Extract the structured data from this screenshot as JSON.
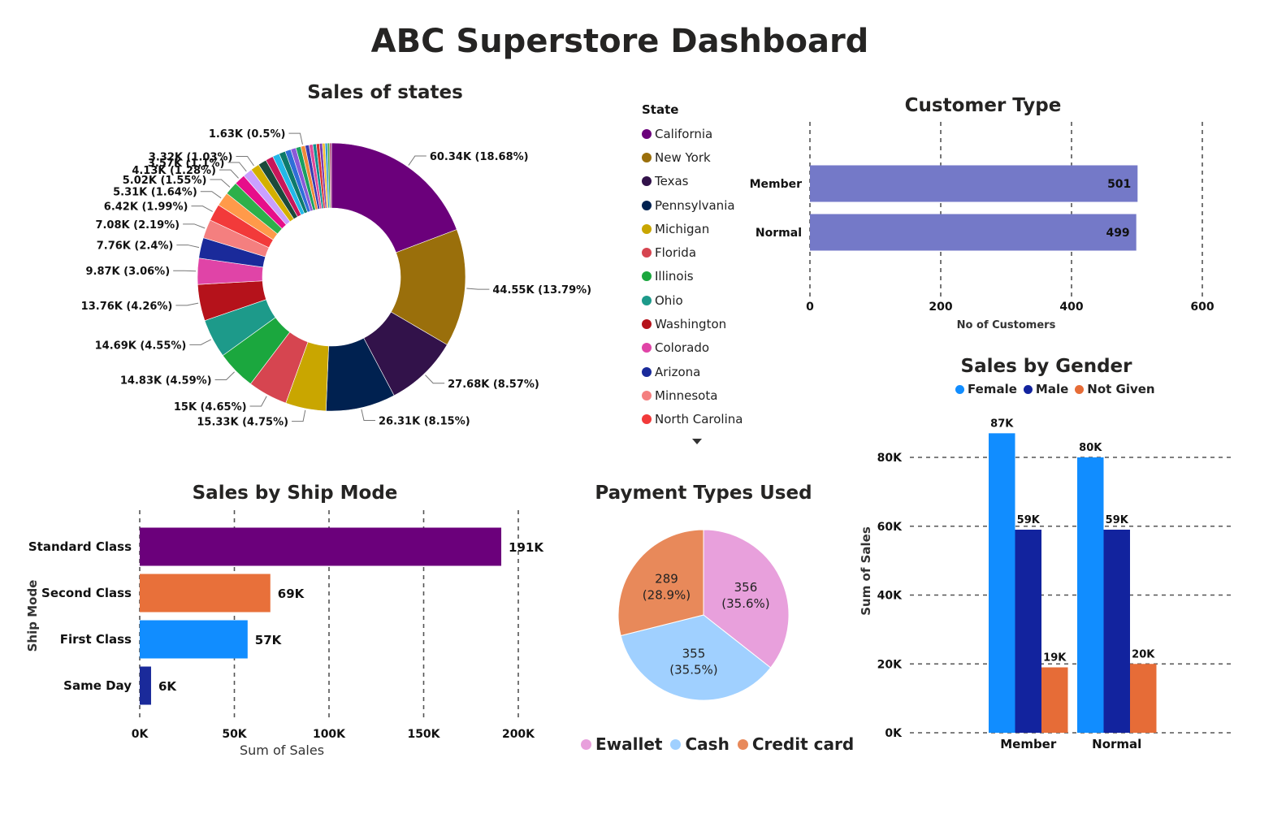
{
  "title": "ABC Superstore Dashboard",
  "chart_data": [
    {
      "type": "pie",
      "variant": "donut",
      "title": "Sales of states",
      "legend_title": "State",
      "legend_placement": "right",
      "slices": [
        {
          "name": "California",
          "value": 60.34,
          "label": "60.34K (18.68%)",
          "color": "#6b007b"
        },
        {
          "name": "New York",
          "value": 44.55,
          "label": "44.55K (13.79%)",
          "color": "#9a6f0b"
        },
        {
          "name": "Texas",
          "value": 27.68,
          "label": "27.68K (8.57%)",
          "color": "#32124a"
        },
        {
          "name": "Pennsylvania",
          "value": 26.31,
          "label": "26.31K (8.15%)",
          "color": "#002150"
        },
        {
          "name": "Michigan",
          "value": 15.33,
          "label": "15.33K (4.75%)",
          "color": "#c9a600"
        },
        {
          "name": "Florida",
          "value": 15,
          "label": "15K (4.65%)",
          "color": "#d64550"
        },
        {
          "name": "Illinois",
          "value": 14.83,
          "label": "14.83K (4.59%)",
          "color": "#1ba73e"
        },
        {
          "name": "Ohio",
          "value": 14.69,
          "label": "14.69K (4.55%)",
          "color": "#1d9a8a"
        },
        {
          "name": "Washington",
          "value": 13.76,
          "label": "13.76K (4.26%)",
          "color": "#b5121b"
        },
        {
          "name": "Colorado",
          "value": 9.87,
          "label": "9.87K (3.06%)",
          "color": "#e044a7"
        },
        {
          "name": "Arizona",
          "value": 7.76,
          "label": "7.76K (2.4%)",
          "color": "#1a2a9a"
        },
        {
          "name": "Minnesota",
          "value": 7.08,
          "label": "7.08K (2.19%)",
          "color": "#f47f7f"
        },
        {
          "name": "North Carolina",
          "value": 6.42,
          "label": "6.42K (1.99%)",
          "color": "#f23a3a"
        },
        {
          "name": "",
          "value": 5.31,
          "label": "5.31K (1.64%)",
          "color": "#ff9a4a"
        },
        {
          "name": "",
          "value": 5.02,
          "label": "5.02K (1.55%)",
          "color": "#2db04a"
        },
        {
          "name": "",
          "value": 4.13,
          "label": "4.13K (1.28%)",
          "color": "#e60e8a"
        },
        {
          "name": "",
          "value": 3.57,
          "label": "3.57K (1.1%)",
          "color": "#c9a0ff"
        },
        {
          "name": "",
          "value": 3.32,
          "label": "3.32K (1.03%)",
          "color": "#d4b000"
        },
        {
          "name": "",
          "value": 3.2,
          "label": "",
          "color": "#1b4a3a"
        },
        {
          "name": "",
          "value": 2.9,
          "label": "",
          "color": "#c8175a"
        },
        {
          "name": "",
          "value": 2.6,
          "label": "",
          "color": "#23b8e8"
        },
        {
          "name": "",
          "value": 2.4,
          "label": "",
          "color": "#0d7a6a"
        },
        {
          "name": "",
          "value": 2.2,
          "label": "",
          "color": "#2f6ed8"
        },
        {
          "name": "",
          "value": 2.0,
          "label": "",
          "color": "#8a5ad8"
        },
        {
          "name": "",
          "value": 1.9,
          "label": "",
          "color": "#1aa060"
        },
        {
          "name": "",
          "value": 1.63,
          "label": "1.63K (0.5%)",
          "color": "#f08a3a"
        },
        {
          "name": "",
          "value": 1.5,
          "label": "",
          "color": "#3c3cb0"
        },
        {
          "name": "",
          "value": 1.4,
          "label": "",
          "color": "#e04a9a"
        },
        {
          "name": "",
          "value": 1.3,
          "label": "",
          "color": "#0f8f8f"
        },
        {
          "name": "",
          "value": 1.2,
          "label": "",
          "color": "#d83030"
        },
        {
          "name": "",
          "value": 1.1,
          "label": "",
          "color": "#7a3ab0"
        },
        {
          "name": "",
          "value": 1.0,
          "label": "",
          "color": "#f0c030"
        },
        {
          "name": "",
          "value": 0.9,
          "label": "",
          "color": "#2a9ad8"
        },
        {
          "name": "",
          "value": 0.8,
          "label": "",
          "color": "#4aa83a"
        },
        {
          "name": "",
          "value": 0.7,
          "label": "",
          "color": "#b04a7a"
        }
      ]
    },
    {
      "type": "bar",
      "orientation": "horizontal",
      "title": "Customer Type",
      "categories": [
        "Member",
        "Normal"
      ],
      "values": [
        501,
        499
      ],
      "data_labels": [
        "501",
        "499"
      ],
      "xlabel": "No of Customers",
      "xlim": [
        0,
        600
      ],
      "ticks": [
        0,
        200,
        400,
        600
      ],
      "tick_labels": [
        "0",
        "200",
        "400",
        "600"
      ],
      "color": "#7479c8",
      "grid": true
    },
    {
      "type": "bar",
      "orientation": "horizontal",
      "title": "Sales by Ship Mode",
      "categories": [
        "Standard Class",
        "Second Class",
        "First Class",
        "Same Day"
      ],
      "values": [
        191,
        69,
        57,
        6
      ],
      "data_labels": [
        "191K",
        "69K",
        "57K",
        "6K"
      ],
      "colors": [
        "#6b007b",
        "#e8703a",
        "#118dff",
        "#1a2a9a"
      ],
      "xlabel": "Sum of Sales",
      "ylabel": "Ship Mode",
      "xlim": [
        0,
        200
      ],
      "ticks": [
        0,
        50,
        100,
        150,
        200
      ],
      "tick_labels": [
        "0K",
        "50K",
        "100K",
        "150K",
        "200K"
      ],
      "grid": true
    },
    {
      "type": "pie",
      "title": "Payment Types Used",
      "slices": [
        {
          "name": "Ewallet",
          "value": 356,
          "label": "356",
          "pct": "(35.6%)",
          "color": "#e8a0dc"
        },
        {
          "name": "Cash",
          "value": 355,
          "label": "355",
          "pct": "(35.5%)",
          "color": "#a0d0ff"
        },
        {
          "name": "Credit card",
          "value": 289,
          "label": "289",
          "pct": "(28.9%)",
          "color": "#e8895a"
        }
      ],
      "legend_placement": "bottom"
    },
    {
      "type": "bar",
      "title": "Sales by Gender",
      "categories": [
        "Member",
        "Normal"
      ],
      "series": [
        {
          "name": "Female",
          "values": [
            87,
            80
          ],
          "labels": [
            "87K",
            "80K"
          ],
          "color": "#118dff"
        },
        {
          "name": "Male",
          "values": [
            59,
            59
          ],
          "labels": [
            "59K",
            "59K"
          ],
          "color": "#12239e"
        },
        {
          "name": "Not Given",
          "values": [
            19,
            20
          ],
          "labels": [
            "19K",
            "20K"
          ],
          "color": "#e66c37"
        }
      ],
      "ylabel": "Sum of Sales",
      "ylim": [
        0,
        80
      ],
      "ticks": [
        0,
        20,
        40,
        60,
        80
      ],
      "tick_labels": [
        "0K",
        "20K",
        "40K",
        "60K",
        "80K"
      ],
      "legend_placement": "top",
      "grid": true
    }
  ]
}
